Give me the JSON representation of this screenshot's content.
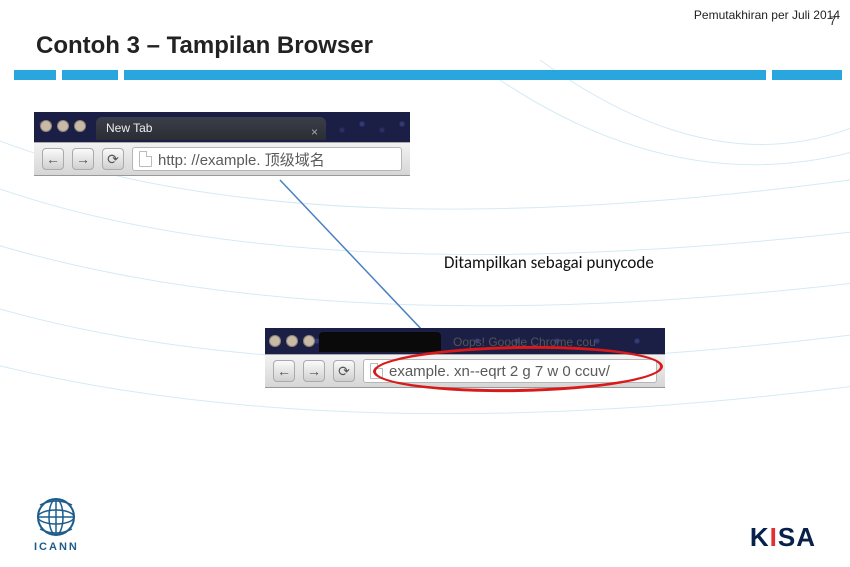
{
  "meta": {
    "update_note": "Pemutakhiran per Juli 2014",
    "page_number": "7"
  },
  "title": "Contoh 3 – Tampilan Browser",
  "browser1": {
    "tab_label": "New Tab",
    "nav_back": "←",
    "nav_fwd": "→",
    "nav_reload": "⟳",
    "url": "http: //example. 顶级域名"
  },
  "caption": "Ditampilkan sebagai punycode",
  "browser2": {
    "error_text": "Oops! Google Chrome cou",
    "nav_back": "←",
    "nav_fwd": "→",
    "nav_reload": "⟳",
    "url": "example. xn--eqrt 2 g 7 w 0 ccuv/"
  },
  "footer": {
    "icann": "ICANN",
    "kisa_k": "K",
    "kisa_i": "I",
    "kisa_sa": "SA"
  }
}
